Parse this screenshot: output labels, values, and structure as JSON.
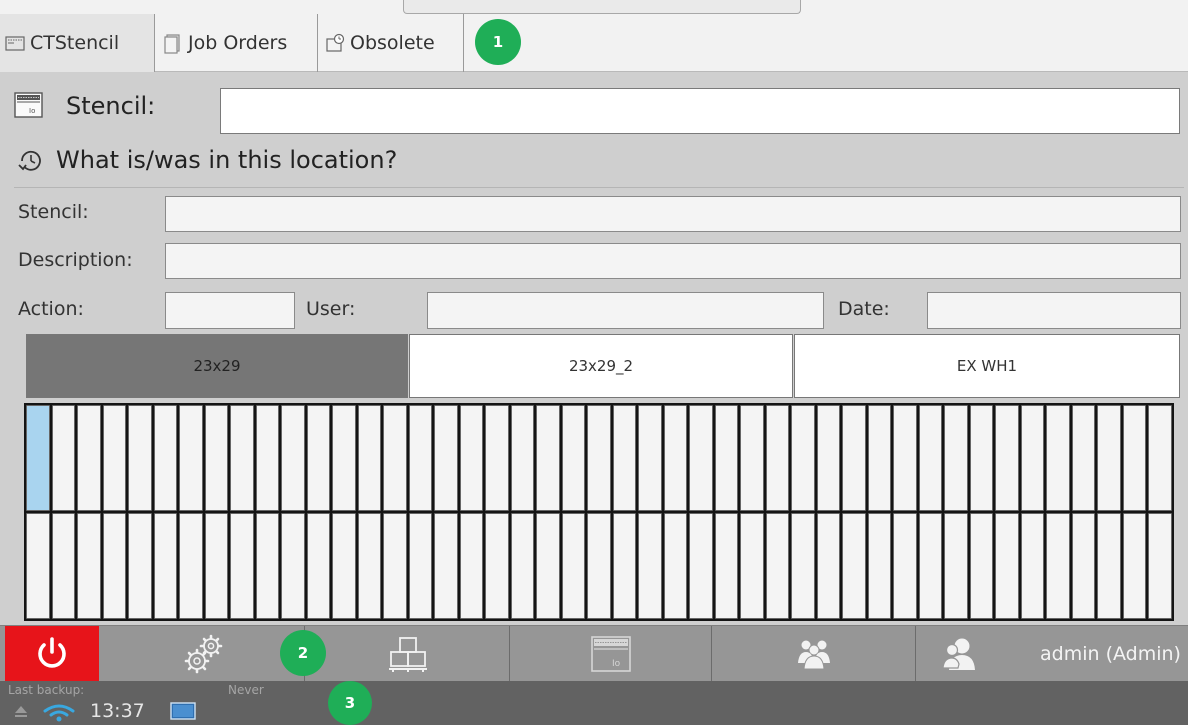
{
  "tabs": [
    {
      "label": "CTStencil",
      "icon": "stencil-icon",
      "active": true
    },
    {
      "label": "Job Orders",
      "icon": "document-icon",
      "active": false
    },
    {
      "label": "Obsolete",
      "icon": "obsolete-icon",
      "active": false
    }
  ],
  "badges": [
    "1",
    "2",
    "3"
  ],
  "search": {
    "label": "Stencil:",
    "value": ""
  },
  "section_title": "What is/was in this location?",
  "details": {
    "stencil_label": "Stencil:",
    "description_label": "Description:",
    "action_label": "Action:",
    "user_label": "User:",
    "date_label": "Date:",
    "stencil_value": "",
    "description_value": "",
    "action_value": "",
    "user_value": "",
    "date_value": ""
  },
  "locations": [
    {
      "label": "23x29",
      "selected": true
    },
    {
      "label": "23x29_2",
      "selected": false
    },
    {
      "label": "EX WH1",
      "selected": false
    }
  ],
  "grid": {
    "rows": 2,
    "columns": 45,
    "highlighted_cell": "row 1, column 1"
  },
  "bottom_bar": {
    "buttons": [
      "power-icon",
      "settings-gears-icon",
      "warehouse-boxes-icon",
      "stencil-icon",
      "users-group-icon",
      "user-profile-icon"
    ],
    "user": "admin (Admin)"
  },
  "status_bar": {
    "last_backup_label": "Last backup:",
    "last_backup_value": "Never",
    "time": "13:37"
  },
  "colors": {
    "accent_green": "#1fae57",
    "power_red": "#e7141a",
    "selected_location": "#767676",
    "highlight_cell": "#a9d4ef"
  }
}
